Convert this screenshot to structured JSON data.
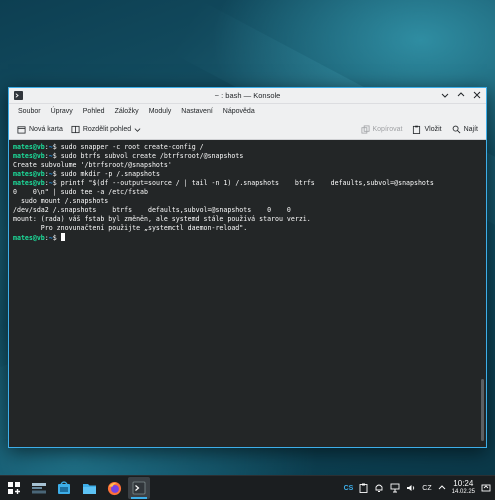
{
  "window": {
    "title": "~ : bash — Konsole",
    "menu": [
      "Soubor",
      "Úpravy",
      "Pohled",
      "Záložky",
      "Moduly",
      "Nastavení",
      "Nápověda"
    ],
    "toolbar": {
      "new_tab": "Nová karta",
      "split_view": "Rozdělit pohled",
      "copy": "Kopírovat",
      "paste": "Vložit",
      "find": "Najít"
    }
  },
  "terminal": {
    "prompt_user": "mates@vb",
    "prompt_path": "~",
    "lines": [
      {
        "type": "prompt",
        "cmd": "sudo snapper -c root create-config /"
      },
      {
        "type": "prompt",
        "cmd": "sudo btrfs subvol create /btrfsroot/@snapshots"
      },
      {
        "type": "output",
        "text": "Create subvolume '/btrfsroot/@snapshots'"
      },
      {
        "type": "prompt",
        "cmd": "sudo mkdir -p /.snapshots"
      },
      {
        "type": "prompt",
        "cmd": "printf \"$(df --output=source / | tail -n 1) /.snapshots    btrfs    defaults,subvol=@snapshots"
      },
      {
        "type": "output",
        "text": "0    0\\n\" | sudo tee -a /etc/fstab"
      },
      {
        "type": "output",
        "text": "  sudo mount /.snapshots"
      },
      {
        "type": "output",
        "text": "/dev/sda2 /.snapshots    btrfs    defaults,subvol=@snapshots    0    0"
      },
      {
        "type": "output",
        "text": "mount: (rada) váš fstab byl změněn, ale systemd stále používá starou verzi."
      },
      {
        "type": "output",
        "text": "       Pro znovunačtení použijte „systemctl daemon-reload\"."
      },
      {
        "type": "prompt_cursor",
        "cmd": ""
      }
    ]
  },
  "taskbar": {
    "apps": [
      "application-launcher-icon",
      "task-manager-icon",
      "discover-store-icon",
      "dolphin-files-icon",
      "firefox-icon",
      "konsole-icon"
    ],
    "tray": {
      "keyboard": "CS",
      "language": "CZ",
      "time": "10:24",
      "date": "14.02.25"
    }
  },
  "colors": {
    "accent": "#3daee9",
    "prompt_user": "#1cdc9a",
    "prompt_path": "#1d99f3",
    "terminal_bg": "#232627"
  }
}
